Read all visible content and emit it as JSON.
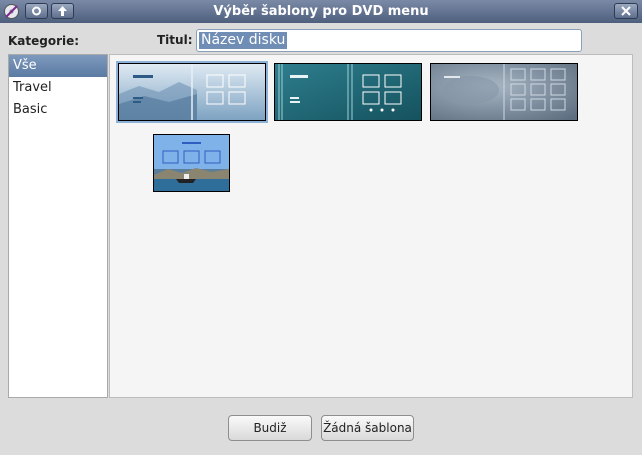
{
  "window": {
    "title": "Výběr šablony pro DVD menu"
  },
  "header": {
    "category_label": "Kategorie:",
    "title_label": "Titul:"
  },
  "title_input": {
    "value": "Název disku"
  },
  "categories": [
    {
      "label": "Vše",
      "selected": true
    },
    {
      "label": "Travel",
      "selected": false
    },
    {
      "label": "Basic",
      "selected": false
    }
  ],
  "templates": [
    {
      "name": "template-blue-mountains",
      "selected": true
    },
    {
      "name": "template-teal-stripes",
      "selected": false
    },
    {
      "name": "template-gray-blur",
      "selected": false
    },
    {
      "name": "template-travel-boat",
      "selected": false
    }
  ],
  "buttons": {
    "ok": "Budiž",
    "none": "Žádná šablona"
  },
  "colors": {
    "titlebar": "#5a6b88",
    "selection": "#6a89b0",
    "accent_border": "#8fb0d8"
  }
}
